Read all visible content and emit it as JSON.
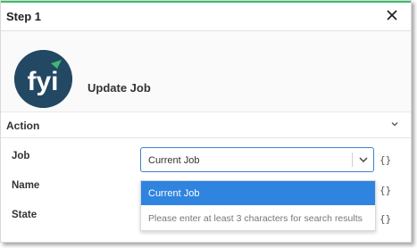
{
  "header": {
    "title": "Step 1"
  },
  "hero": {
    "logo_text": "fyi",
    "title": "Update Job"
  },
  "section": {
    "title": "Action"
  },
  "fields": {
    "job": {
      "label": "Job",
      "value": "Current Job",
      "braces": "{}"
    },
    "name": {
      "label": "Name",
      "braces": "{}"
    },
    "state": {
      "label": "State",
      "braces": "{}"
    }
  },
  "dropdown": {
    "selected_option": "Current Job",
    "hint": "Please enter at least 3 characters for search results"
  },
  "colors": {
    "accent_line": "#3dbb6b",
    "logo_bg": "#234863",
    "selection": "#2f84e0",
    "focus_border": "#3d82cf"
  }
}
